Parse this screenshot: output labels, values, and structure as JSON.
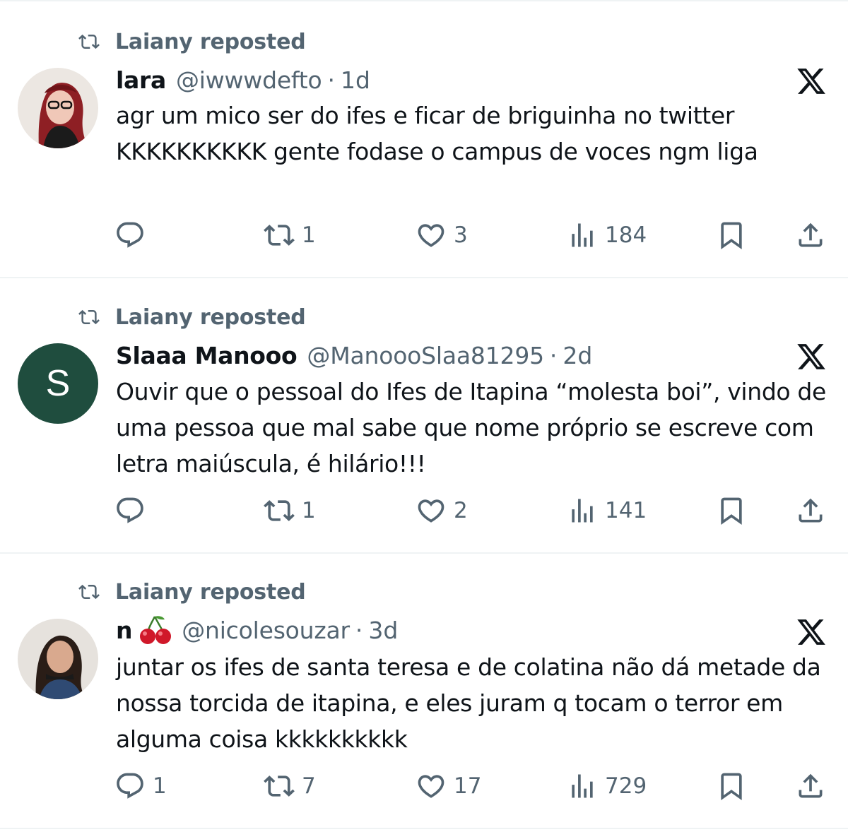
{
  "feed": {
    "tweets": [
      {
        "repost_label": "Laiany reposted",
        "display_name": "lara",
        "handle": "@iwwwdefto",
        "separator": "·",
        "time": "1d",
        "avatar": "photo-avatar-red-hair-glasses",
        "text": "agr um mico ser do ifes e ficar de briguinha no twitter KKKKKKKKKK gente fodase o campus de voces ngm liga",
        "counts": {
          "reply": "",
          "repost": "1",
          "like": "3",
          "views": "184"
        }
      },
      {
        "repost_label": "Laiany reposted",
        "display_name": "Slaaa Manooo",
        "handle": "@ManoooSlaa81295",
        "separator": "·",
        "time": "2d",
        "avatar_letter": "S",
        "avatar_color": "#1f4d3e",
        "text": "Ouvir que o pessoal do Ifes de Itapina “molesta boi”, vindo de uma pessoa que mal sabe que nome próprio se escreve com letra maiúscula, é hilário!!!",
        "counts": {
          "reply": "",
          "repost": "1",
          "like": "2",
          "views": "141"
        }
      },
      {
        "repost_label": "Laiany reposted",
        "display_name": "n",
        "name_emoji": "cherries-emoji",
        "handle": "@nicolesouzar",
        "separator": "·",
        "time": "3d",
        "avatar": "photo-avatar-dark-hair",
        "text": "juntar os ifes de santa teresa e de colatina não dá metade da nossa torcida de itapina, e eles juram q tocam o terror em alguma coisa kkkkkkkkkk",
        "counts": {
          "reply": "1",
          "repost": "7",
          "like": "17",
          "views": "729"
        }
      }
    ]
  },
  "colors": {
    "text_primary": "#0f1419",
    "text_secondary": "#536471",
    "divider": "#eff3f4",
    "avatar_s_bg": "#1f4d3e"
  },
  "icons": [
    "repost-icon",
    "x-logo-icon",
    "reply-icon",
    "like-icon",
    "views-icon",
    "bookmark-icon",
    "share-icon",
    "cherries-emoji"
  ]
}
